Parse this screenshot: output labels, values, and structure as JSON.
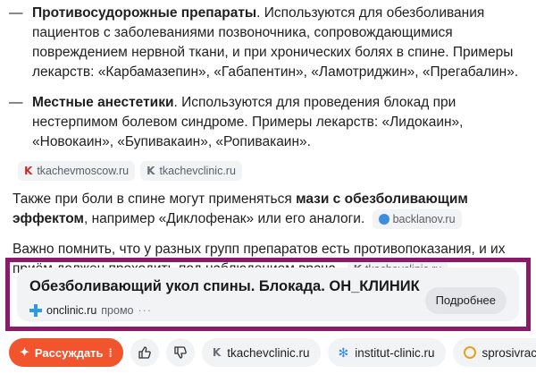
{
  "list": [
    {
      "bold": "Противосудорожные препараты",
      "text": ". Используются для обезболивания пациентов с заболеваниями позвоночника, сопровождающимися повреждением нервной ткани, и при хронических болях в спине. Примеры лекарств: «Карбамазепин», «Габапентин», «Ламотриджин», «Прегабалин»."
    },
    {
      "bold": "Местные анестетики",
      "text": ". Используются для проведения блокад при нестерпимом болевом синдроме. Примеры лекарств: «Лидокаин», «Новокаин», «Бупивакаин», «Ропивакаин»."
    }
  ],
  "list_dash": "—",
  "sources": [
    "tkachevmoscow.ru",
    "tkachevclinic.ru"
  ],
  "para1": {
    "text1": "Также при боли в спине могут применяться ",
    "bold": "мази с обезболивающим эффектом",
    "text2": ", например «Диклофенак» или его аналоги.",
    "source": "backlanov.ru"
  },
  "para2": {
    "text": "Важно помнить, что у разных групп препаратов есть противопоказания, и их приём должен проходить под наблюдением врача.",
    "source": "tkachevclinic.ru"
  },
  "ad": {
    "title": "Обезболивающий укол спины. Блокада. ОН_КЛИНИК",
    "domain": "onclinic.ru",
    "label": "промо",
    "more_dots": "···",
    "button": "Подробнее"
  },
  "bottom": {
    "reason_button": "Рассуждать",
    "chips": [
      "tkachevclinic.ru",
      "institut-clinic.ru",
      "sprosivracha"
    ]
  },
  "colors": {
    "ad_frame": "#8b1a6b",
    "reason_button": "#f2542d"
  }
}
